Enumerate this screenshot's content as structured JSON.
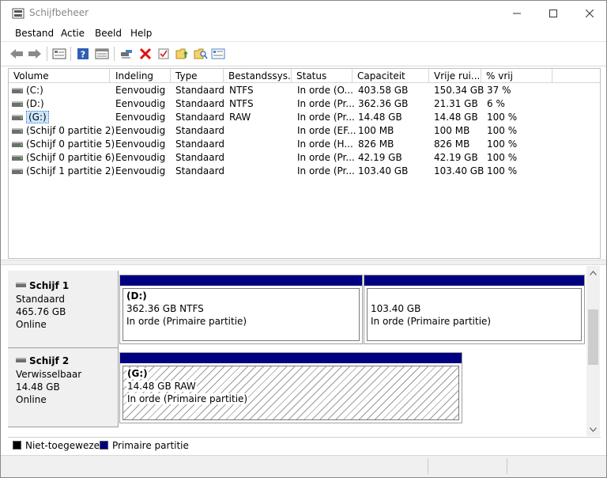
{
  "window": {
    "title": "Schijfbeheer"
  },
  "menu": [
    "Bestand",
    "Actie",
    "Beeld",
    "Help"
  ],
  "toolbar": {
    "icons": [
      "back-icon",
      "forward-icon",
      "disk-list-icon",
      "help-icon",
      "properties-icon",
      "connect-icon",
      "delete-icon",
      "check-icon",
      "folder-up-icon",
      "folder-search-icon",
      "details-icon"
    ]
  },
  "volume_list": {
    "columns": [
      "Volume",
      "Indeling",
      "Type",
      "Bestandssys...",
      "Status",
      "Capaciteit",
      "Vrije rui...",
      "% vrij"
    ],
    "rows": [
      {
        "volume": "(C:)",
        "indeling": "Eenvoudig",
        "type": "Standaard",
        "fs": "NTFS",
        "status": "In orde (O...",
        "capaciteit": "403.58 GB",
        "vrij": "150.34 GB",
        "pct": "37 %"
      },
      {
        "volume": "(D:)",
        "indeling": "Eenvoudig",
        "type": "Standaard",
        "fs": "NTFS",
        "status": "In orde (Pr...",
        "capaciteit": "362.36 GB",
        "vrij": "21.31 GB",
        "pct": "6 %"
      },
      {
        "volume": "(G:)",
        "indeling": "Eenvoudig",
        "type": "Standaard",
        "fs": "RAW",
        "status": "In orde (Pr...",
        "capaciteit": "14.48 GB",
        "vrij": "14.48 GB",
        "pct": "100 %"
      },
      {
        "volume": "(Schijf 0 partitie 2)",
        "indeling": "Eenvoudig",
        "type": "Standaard",
        "fs": "",
        "status": "In orde (EF...",
        "capaciteit": "100 MB",
        "vrij": "100 MB",
        "pct": "100 %"
      },
      {
        "volume": "(Schijf 0 partitie 5)",
        "indeling": "Eenvoudig",
        "type": "Standaard",
        "fs": "",
        "status": "In orde (H...",
        "capaciteit": "826 MB",
        "vrij": "826 MB",
        "pct": "100 %"
      },
      {
        "volume": "(Schijf 0 partitie 6)",
        "indeling": "Eenvoudig",
        "type": "Standaard",
        "fs": "",
        "status": "In orde (Pr...",
        "capaciteit": "42.19 GB",
        "vrij": "42.19 GB",
        "pct": "100 %"
      },
      {
        "volume": "(Schijf 1 partitie 2)",
        "indeling": "Eenvoudig",
        "type": "Standaard",
        "fs": "",
        "status": "In orde (Pr...",
        "capaciteit": "103.40 GB",
        "vrij": "103.40 GB",
        "pct": "100 %"
      }
    ],
    "selected_row": 2
  },
  "disks": [
    {
      "name": "Schijf 1",
      "kind": "Standaard",
      "size": "465.76 GB",
      "state": "Online",
      "partitions": [
        {
          "title": "(D:)",
          "size_fs": "362.36 GB NTFS",
          "status": "In orde (Primaire partitie)"
        },
        {
          "title": "",
          "size_fs": "103.40 GB",
          "status": "In orde (Primaire partitie)"
        }
      ]
    },
    {
      "name": "Schijf 2",
      "kind": "Verwisselbaar",
      "size": "14.48 GB",
      "state": "Online",
      "partitions": [
        {
          "title": "(G:)",
          "size_fs": "14.48 GB RAW",
          "status": "In orde (Primaire partitie)"
        }
      ]
    }
  ],
  "legend": [
    {
      "label": "Niet-toegewezen",
      "color": "#000000"
    },
    {
      "label": "Primaire partitie",
      "color": "#000080"
    }
  ],
  "colors": {
    "partition_header": "#000080",
    "selection": "#cce8ff"
  }
}
